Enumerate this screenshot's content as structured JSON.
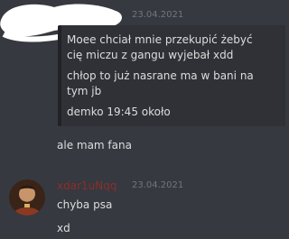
{
  "top_message": {
    "timestamp": "23.04.2021",
    "lines": [
      "Moee chciał mnie przekupić żebyć",
      "cię miczu z gangu wyjebał xdd",
      "chłop to już nasrane ma w bani na",
      "tym jb",
      "demko 19:45 około"
    ]
  },
  "follow_message": "ale mam fana",
  "second_author": {
    "username": "xdar1uNqq",
    "username_color": "#8b2e2e",
    "timestamp": "23.04.2021",
    "messages": [
      "chyba psa",
      "xd"
    ]
  },
  "colors": {
    "background": "#36393f",
    "embed_background": "#2f3136",
    "text": "#dcddde",
    "muted": "#72767d"
  }
}
